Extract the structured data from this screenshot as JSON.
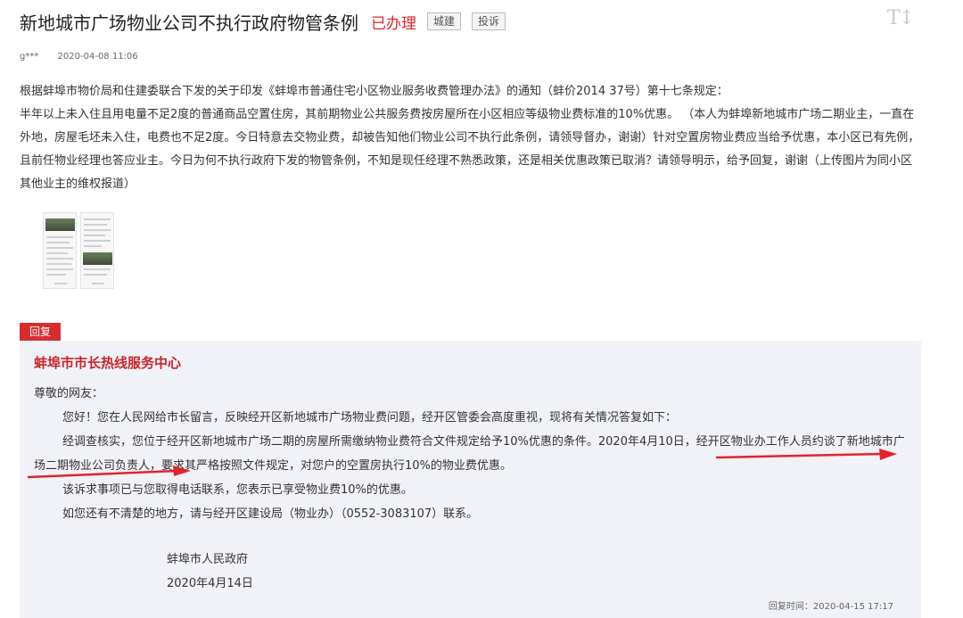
{
  "header": {
    "title": "新地城市广场物业公司不执行政府物管条例",
    "status": "已办理",
    "tag_category": "城建",
    "tag_type": "投诉",
    "font_toggle": "T↕"
  },
  "meta": {
    "user": "g***",
    "time": "2020-04-08 11:06"
  },
  "complaint": {
    "p1": "根据蚌埠市物价局和住建委联合下发的关于印发《蚌埠市普通住宅小区物业服务收费管理办法》的通知（蚌价2014 37号）第十七条规定：",
    "p2": "半年以上未入住且用电量不足2度的普通商品空置住房，其前期物业公共服务费按房屋所在小区相应等级物业费标准的10%优惠。 （本人为蚌埠新地城市广场二期业主，一直在外地，房屋毛坯未入住，电费也不足2度。今日特意去交物业费，却被告知他们物业公司不执行此条例，请领导督办，谢谢）针对空置房物业费应当给予优惠，本小区已有先例，且前任物业经理也答应业主。今日为何不执行政府下发的物管条例，不知是现任经理不熟悉政策，还是相关优惠政策已取消？请领导明示，给予回复，谢谢（上传图片为同小区其他业主的维权报道）"
  },
  "reply": {
    "tab_label": "回复",
    "org": "蚌埠市市长热线服务中心",
    "greeting": "尊敬的网友：",
    "para1": "您好！您在人民网给市长留言，反映经开区新地城市广场物业费问题，经开区管委会高度重视，现将有关情况答复如下：",
    "para2": "经调查核实，您位于经开区新地城市广场二期的房屋所需缴纳物业费符合文件规定给予10%优惠的条件。2020年4月10日，经开区物业办工作人员约谈了新地城市广场二期物业公司负责人，要求其严格按照文件规定，对您户的空置房执行10%的物业费优惠。",
    "para3": "该诉求事项已与您取得电话联系，您表示已享受物业费10%的优惠。",
    "para4": "如您还有不清楚的地方，请与经开区建设局（物业办）（0552-3083107）联系。",
    "signature": "蚌埠市人民政府",
    "date": "2020年4月14日",
    "reply_time": "回复时间：2020-04-15 17:17"
  },
  "colors": {
    "accent_red": "#d72d2f",
    "reply_bg": "#f1f2f7"
  }
}
